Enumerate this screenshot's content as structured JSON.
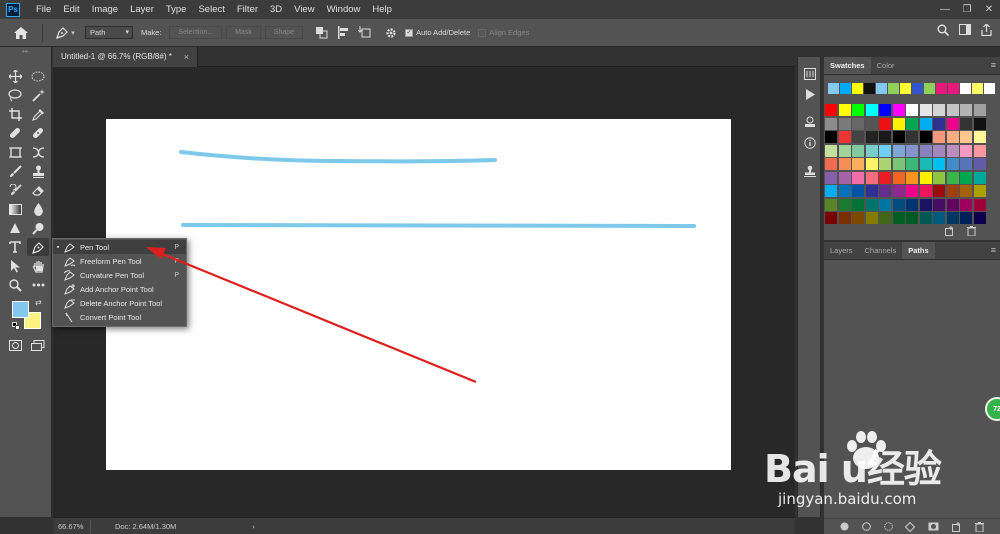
{
  "app": {
    "logo": "Ps"
  },
  "menu": [
    "File",
    "Edit",
    "Image",
    "Layer",
    "Type",
    "Select",
    "Filter",
    "3D",
    "View",
    "Window",
    "Help"
  ],
  "window_controls": {
    "minimize": "—",
    "maximize": "❐",
    "close": "✕"
  },
  "options_bar": {
    "mode_value": "Path",
    "make_label": "Make:",
    "selection_button": "Selection...",
    "mask_button": "Mask",
    "shape_button": "Shape",
    "auto_add_delete": "Auto Add/Delete",
    "auto_add_delete_checked": true,
    "align_edges": "Align Edges"
  },
  "document": {
    "tab_title": "Untitled-1 @ 66.7% (RGB/8#) *",
    "close": "×"
  },
  "flyout": {
    "items": [
      {
        "label": "Pen Tool",
        "shortcut": "P",
        "selected": true,
        "bullet": "▪"
      },
      {
        "label": "Freeform Pen Tool",
        "shortcut": "P",
        "selected": false,
        "bullet": ""
      },
      {
        "label": "Curvature Pen Tool",
        "shortcut": "P",
        "selected": false,
        "bullet": ""
      },
      {
        "label": "Add Anchor Point Tool",
        "shortcut": "",
        "selected": false,
        "bullet": ""
      },
      {
        "label": "Delete Anchor Point Tool",
        "shortcut": "",
        "selected": false,
        "bullet": ""
      },
      {
        "label": "Convert Point Tool",
        "shortcut": "",
        "selected": false,
        "bullet": ""
      }
    ]
  },
  "colors": {
    "foreground": "#83c8ee",
    "background": "#fcf281",
    "stroke": "#7ec8ea",
    "arrow": "#dd1f1f"
  },
  "status": {
    "zoom": "66.67%",
    "doc_info": "Doc: 2.64M/1.30M",
    "arrow": "›"
  },
  "swatches_panel": {
    "tabs": [
      "Swatches",
      "Color"
    ],
    "active_tab": "Swatches",
    "recent": [
      "#83c8ee",
      "#00aaff",
      "#ffff00",
      "#111111",
      "#83c8ee",
      "#8fcf5a",
      "#ffff33",
      "#3355cc",
      "#8fcf5a",
      "#e8197d",
      "#e8197d",
      "#ffffff",
      "#ffff66",
      "#ffffff"
    ],
    "grid": [
      "#ff0000",
      "#ffff00",
      "#00ff00",
      "#00ffff",
      "#0000ff",
      "#ff00ff",
      "#ffffff",
      "#e6e6e6",
      "#d4d4d4",
      "#c4c4c4",
      "#b3b3b3",
      "#a0a0a0",
      "#8c8c8c",
      "#7a7a7a",
      "#676767",
      "#555555",
      "#ee1111",
      "#fff200",
      "#00a651",
      "#00aeef",
      "#2e3192",
      "#ec008c",
      "#333333",
      "#111111",
      "#000000",
      "#ee3333",
      "#444444",
      "#222222",
      "#1a1a1a",
      "#000000",
      "#333333",
      "#000000",
      "#f7977a",
      "#f9ad81",
      "#fdc68a",
      "#fff79a",
      "#c4df9b",
      "#a3d39c",
      "#82ca9d",
      "#7bcdc8",
      "#6ecff6",
      "#7ea7d8",
      "#8493ca",
      "#8882be",
      "#a187be",
      "#bc8dbf",
      "#f49ac2",
      "#f6989d",
      "#f26c4f",
      "#f68e55",
      "#fbaf5c",
      "#fff467",
      "#acd372",
      "#7cc576",
      "#3bb878",
      "#1abbb4",
      "#00bff3",
      "#438ccb",
      "#5574b9",
      "#605ca8",
      "#855fa8",
      "#a763a8",
      "#f06ea9",
      "#f26d7d",
      "#ed1c24",
      "#f26522",
      "#f7941d",
      "#fff200",
      "#8dc63f",
      "#39b54a",
      "#00a651",
      "#00a99d",
      "#00aeef",
      "#0072bc",
      "#0054a6",
      "#2e3192",
      "#662d91",
      "#92278f",
      "#ec008c",
      "#ed145b",
      "#9e0b0f",
      "#a0410d",
      "#a36209",
      "#aba000",
      "#598527",
      "#197b30",
      "#007236",
      "#00746b",
      "#0076a3",
      "#004b80",
      "#003471",
      "#1b1464",
      "#440e62",
      "#630460",
      "#9e005d",
      "#9e0039",
      "#790000",
      "#7b2e00",
      "#7d4900",
      "#827b00",
      "#406618",
      "#005e20",
      "#005826",
      "#005952",
      "#005b7f",
      "#003663",
      "#002157",
      "#0d004c"
    ]
  },
  "layers_panel": {
    "tabs": [
      "Layers",
      "Channels",
      "Paths"
    ],
    "active_tab": "Paths"
  },
  "badge": {
    "text": "72"
  },
  "watermark": {
    "logo": "Baiдu经验",
    "url": "jingyan.baidu.com"
  }
}
